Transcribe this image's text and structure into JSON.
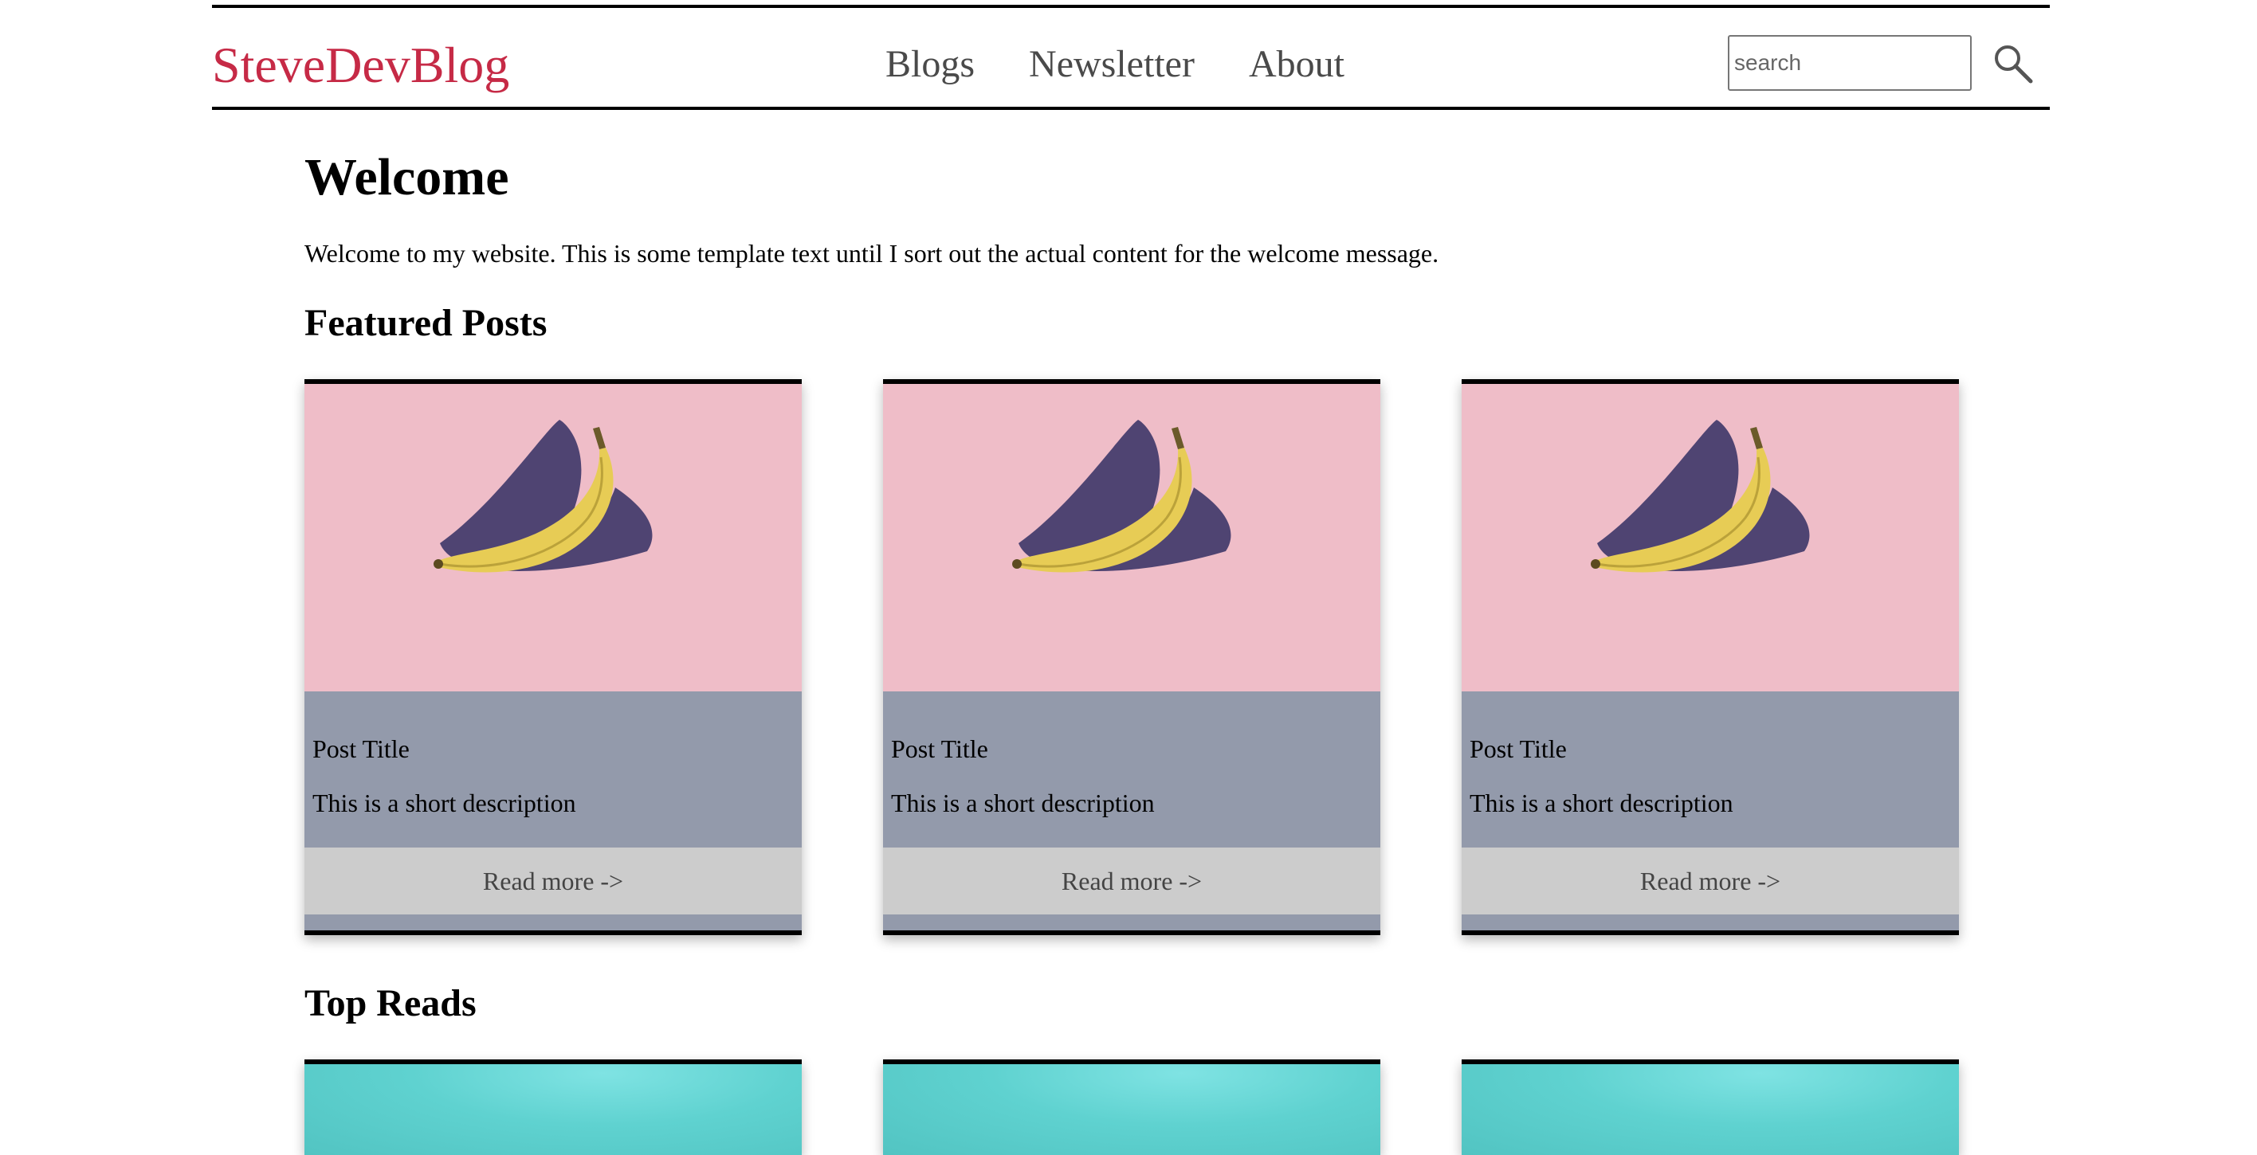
{
  "header": {
    "logo": "SteveDevBlog",
    "nav": [
      "Blogs",
      "Newsletter",
      "About"
    ],
    "search_placeholder": "search",
    "search_icon": "magnifier-icon"
  },
  "main": {
    "welcome_title": "Welcome",
    "welcome_text": "Welcome to my website. This is some template text until I sort out the actual content for the welcome message.",
    "featured_heading": "Featured Posts",
    "top_reads_heading": "Top Reads",
    "featured_posts": [
      {
        "title": "Post Title",
        "description": "This is a short description",
        "read_more": "Read more ->",
        "image": "banana-image"
      },
      {
        "title": "Post Title",
        "description": "This is a short description",
        "read_more": "Read more ->",
        "image": "banana-image"
      },
      {
        "title": "Post Title",
        "description": "This is a short description",
        "read_more": "Read more ->",
        "image": "banana-image"
      }
    ]
  },
  "colors": {
    "brand": "#c62a46",
    "card_image_bg": "#efbdc8",
    "card_body_bg": "#939aab",
    "read_more_bg": "#cccccc",
    "top_reads_bg": "#5fd2d0"
  }
}
